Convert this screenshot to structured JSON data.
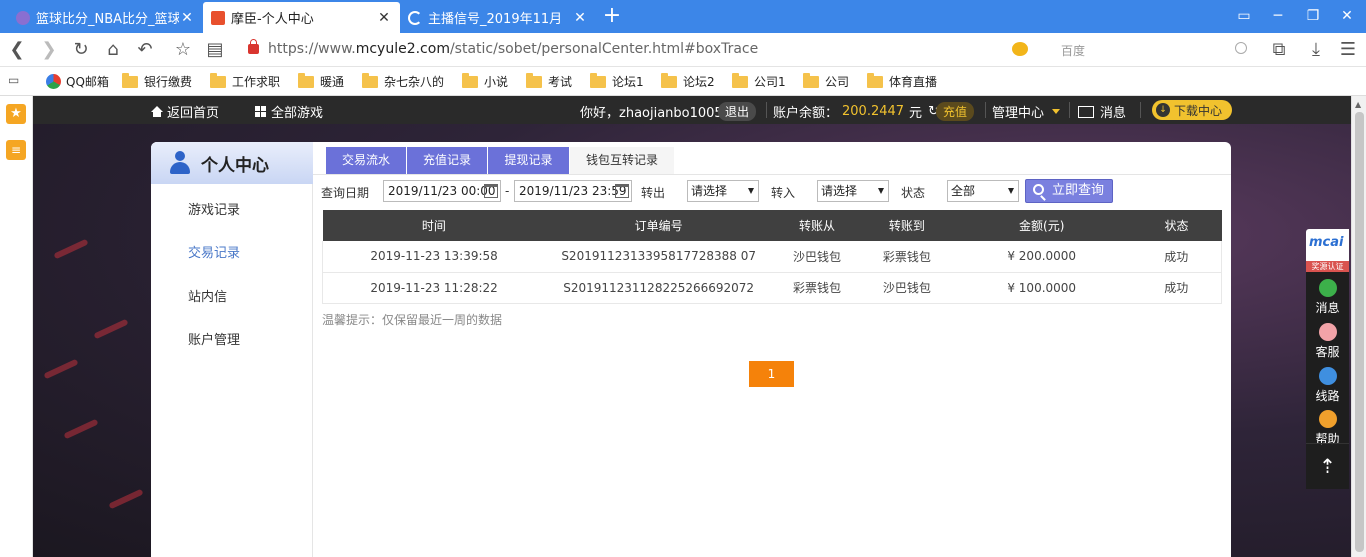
{
  "browser": {
    "tabs": [
      {
        "title": "篮球比分_NBA比分_篮球比",
        "active": false
      },
      {
        "title": "摩臣-个人中心",
        "active": true
      },
      {
        "title": "主播信号_2019年11月",
        "active": false
      }
    ],
    "new_tab": "+",
    "url_prefix": "https://www.",
    "url_domain": "mcyule2.com",
    "url_path": "/static/sobet/personalCenter.html#boxTrace",
    "search_placeholder": "百度",
    "bookmarks": [
      "QQ邮箱",
      "银行缴费",
      "工作求职",
      "暖通",
      "杂七杂八的",
      "小说",
      "考试",
      "论坛1",
      "论坛2",
      "公司1",
      "公司",
      "体育直播"
    ]
  },
  "site": {
    "home": "返回首页",
    "all_games": "全部游戏",
    "greeting": "你好，zhaojianbo1005",
    "logout": "退出",
    "balance_label": "账户余额：",
    "balance_value": "200.2447",
    "balance_unit": "元",
    "recharge": "充值",
    "manage": "管理中心",
    "messages": "消息",
    "download": "下载中心"
  },
  "sidebar": {
    "title": "个人中心",
    "items": [
      "游戏记录",
      "交易记录",
      "站内信",
      "账户管理"
    ],
    "active_index": 1
  },
  "tabs": [
    "交易流水",
    "充值记录",
    "提现记录",
    "钱包互转记录"
  ],
  "active_tab": 3,
  "filters": {
    "date_label": "查询日期",
    "date_from": "2019/11/23 00:00",
    "separator": "-",
    "date_to": "2019/11/23 23:59",
    "out_label": "转出",
    "out_value": "请选择",
    "in_label": "转入",
    "in_value": "请选择",
    "status_label": "状态",
    "status_value": "全部",
    "query_button": "立即查询"
  },
  "table": {
    "headers": [
      "时间",
      "订单编号",
      "转账从",
      "转账到",
      "金额(元)",
      "状态"
    ],
    "rows": [
      [
        "2019-11-23 13:39:58",
        "S2019112313395817728388 07",
        "沙巴钱包",
        "彩票钱包",
        "¥ 200.0000",
        "成功"
      ],
      [
        "2019-11-23 11:28:22",
        "S201911231128225266692072",
        "彩票钱包",
        "沙巴钱包",
        "¥ 100.0000",
        "成功"
      ]
    ]
  },
  "tip": "温馨提示：仅保留最近一周的数据",
  "pager": {
    "current": "1"
  },
  "rightfloat": {
    "logo": "mcai",
    "logo_sub": "奖源认证",
    "items": [
      "消息",
      "客服",
      "线路",
      "帮助"
    ],
    "top": "⇡"
  }
}
